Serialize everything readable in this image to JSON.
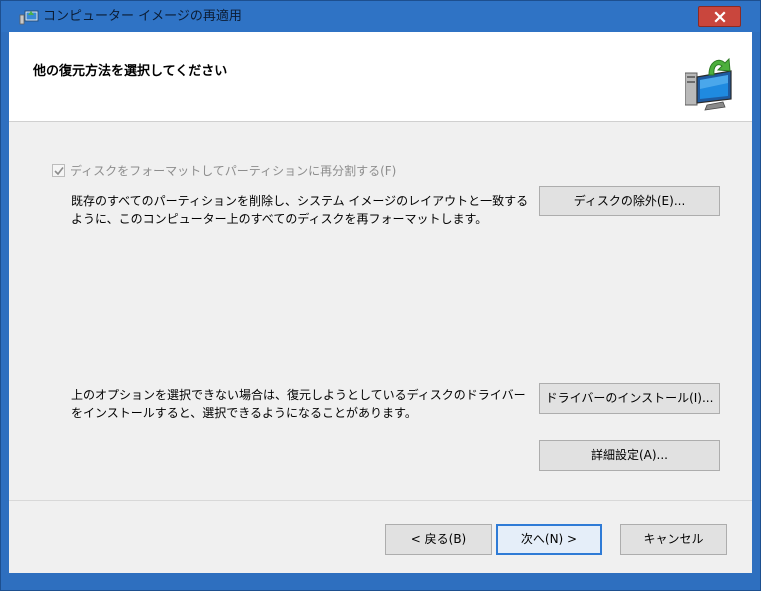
{
  "window": {
    "title": "コンピューター イメージの再適用",
    "close_icon": "close-icon"
  },
  "header": {
    "title": "他の復元方法を選択してください",
    "icon": "computer-restore-icon"
  },
  "format_option": {
    "checkbox_label": "ディスクをフォーマットしてパーティションに再分割する(F)",
    "checked": true,
    "disabled": true,
    "description_line1": "既存のすべてのパーティションを削除し、システム イメージのレイアウトと一致する",
    "description_line2": "ように、このコンピューター上のすべてのディスクを再フォーマットします。",
    "exclude_button": "ディスクの除外(E)..."
  },
  "driver_option": {
    "description_line1": "上のオプションを選択できない場合は、復元しようとしているディスクのドライバー",
    "description_line2": "をインストールすると、選択できるようになることがあります。",
    "install_button": "ドライバーのインストール(I)..."
  },
  "advanced_button": "詳細設定(A)...",
  "footer": {
    "back_button": "< 戻る(B)",
    "next_button": "次へ(N) >",
    "cancel_button": "キャンセル"
  },
  "colors": {
    "title_bar": "#2f73c5",
    "close_button": "#c9463d",
    "dialog_bg": "#f0f0f0",
    "default_button_border": "#2f7bd6"
  }
}
